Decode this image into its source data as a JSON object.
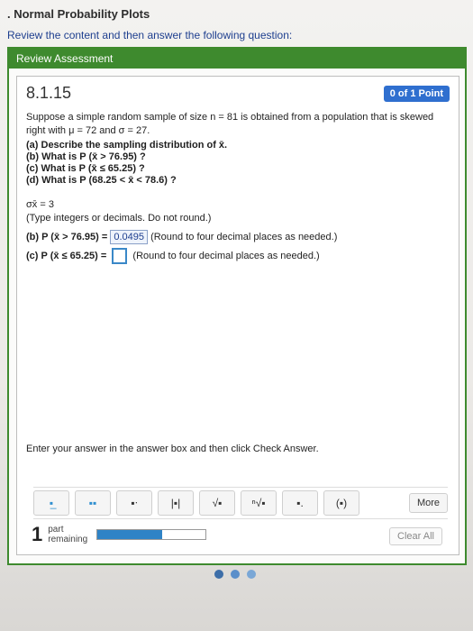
{
  "header": {
    "breadcrumb": ". Normal Probability Plots",
    "instruction": "Review the content and then answer the following question:"
  },
  "panel": {
    "title": "Review Assessment"
  },
  "question": {
    "number": "8.1.15",
    "points": "0 of 1 Point",
    "stem": "Suppose a simple random sample of size n = 81 is obtained from a population that is skewed right with μ = 72 and σ = 27.",
    "parts": [
      "(a) Describe the sampling distribution of x̄.",
      "(b) What is P (x̄ > 76.95) ?",
      "(c) What is P (x̄ ≤ 65.25) ?",
      "(d) What is P (68.25 < x̄ < 78.6) ?"
    ],
    "sigma_line": "σx̄ = 3",
    "sigma_hint": "(Type integers or decimals. Do not round.)",
    "part_b_label": "(b) P (x̄ > 76.95) =",
    "part_b_value": "0.0495",
    "part_b_hint": "(Round to four decimal places as needed.)",
    "part_c_label": "(c) P (x̄ ≤ 65.25) =",
    "part_c_hint": "(Round to four decimal places as needed.)",
    "instructions": "Enter your answer in the answer box and then click Check Answer."
  },
  "toolbar": {
    "buttons": [
      {
        "icon": "fraction-icon",
        "glyph": "▪̲"
      },
      {
        "icon": "mixed-fraction-icon",
        "glyph": "▪▪"
      },
      {
        "icon": "exponent-icon",
        "glyph": "▪ᐧ"
      },
      {
        "icon": "absolute-value-icon",
        "glyph": "|▪|"
      },
      {
        "icon": "square-root-icon",
        "glyph": "√▪"
      },
      {
        "icon": "nth-root-icon",
        "glyph": "ⁿ√▪"
      },
      {
        "icon": "decimal-icon",
        "glyph": "▪."
      },
      {
        "icon": "interval-icon",
        "glyph": "(▪)"
      }
    ],
    "more_label": "More"
  },
  "footer": {
    "remaining_count": "1",
    "remaining_text_1": "part",
    "remaining_text_2": "remaining",
    "progress_fraction": 0.6,
    "clear_all_label": "Clear All"
  },
  "colors": {
    "accent_green": "#3e8a2e",
    "badge_blue": "#2f6fcf",
    "progress_blue": "#2f83c6"
  }
}
